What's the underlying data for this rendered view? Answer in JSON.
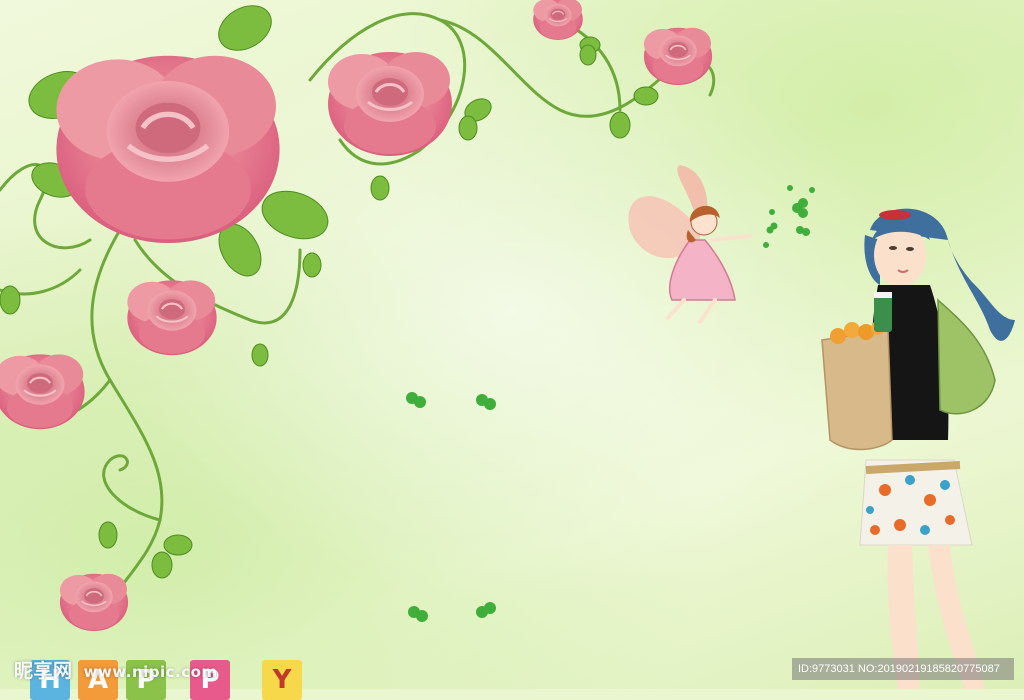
{
  "watermark": {
    "site_name": "昵享网",
    "site_url": "www.nipic.com",
    "image_id": "ID:9773031 NO:20190219185820775087"
  },
  "happy_blocks": [
    "H",
    "A",
    "P",
    "P",
    "Y"
  ],
  "colors": {
    "background": "#eaf6cf",
    "rose": "#e6738a",
    "leaf": "#78b83c",
    "vine": "#6ea83a",
    "clover": "#3fae3a"
  }
}
